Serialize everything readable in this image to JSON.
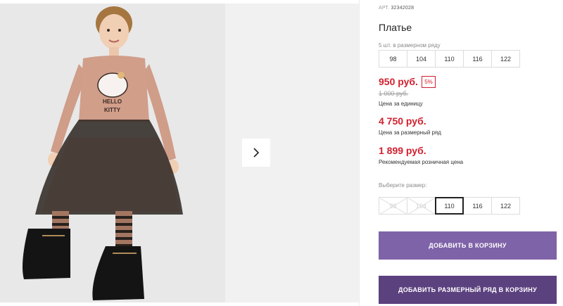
{
  "gallery": {
    "photo_alt": "",
    "next_icon": "chevron-right-icon"
  },
  "product": {
    "article_prefix": "АРТ.",
    "article_number": "32342028",
    "title": "Платье",
    "pack_label": "5 шт. в размерном ряду",
    "pack_sizes": [
      "98",
      "104",
      "110",
      "116",
      "122"
    ],
    "price_unit": "950 руб.",
    "discount": "5%",
    "old_price": "1 000 руб.",
    "price_unit_note": "Цена за единицу",
    "price_pack": "4 750 руб.",
    "price_pack_note": "Цена за размерный ряд",
    "price_retail": "1 899 руб.",
    "price_retail_note": "Рекомендуемая розничная цена",
    "choose_size_label": "Выберите размер:",
    "sizes": [
      {
        "label": "98",
        "state": "disabled"
      },
      {
        "label": "104",
        "state": "disabled"
      },
      {
        "label": "110",
        "state": "selected"
      },
      {
        "label": "116",
        "state": "available"
      },
      {
        "label": "122",
        "state": "available"
      }
    ]
  },
  "actions": {
    "add_to_cart": "ДОБАВИТЬ В КОРЗИНУ",
    "add_pack_to_cart": "ДОБАВИТЬ РАЗМЕРНЫЙ РЯД В КОРЗИНУ"
  },
  "colors": {
    "price_red": "#d11f2e",
    "button_primary": "#7f63a8",
    "button_secondary": "#5c417f"
  }
}
